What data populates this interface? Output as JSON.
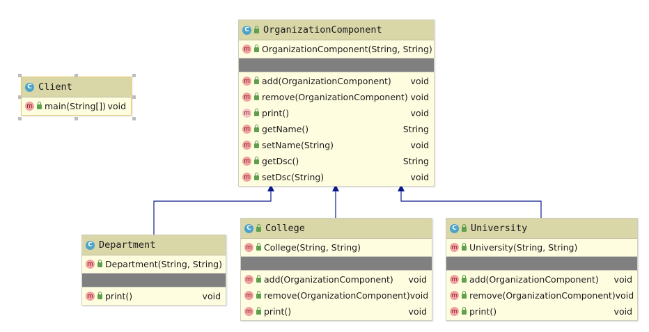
{
  "classes": {
    "client": {
      "icon": "class-icon",
      "name": "Client",
      "methods": [
        {
          "icon": "method-icon",
          "name": "main(String[])",
          "ret": "void"
        }
      ]
    },
    "organization": {
      "icon": "abstract-class-icon",
      "name": "OrganizationComponent",
      "constructors": [
        {
          "name": "OrganizationComponent(String, String)"
        }
      ],
      "methods": [
        {
          "name": "add(OrganizationComponent)",
          "ret": "void"
        },
        {
          "name": "remove(OrganizationComponent)",
          "ret": "void"
        },
        {
          "name": "print()",
          "ret": "void",
          "abstract": true
        },
        {
          "name": "getName()",
          "ret": "String"
        },
        {
          "name": "setName(String)",
          "ret": "void"
        },
        {
          "name": "getDsc()",
          "ret": "String"
        },
        {
          "name": "setDsc(String)",
          "ret": "void"
        }
      ]
    },
    "department": {
      "icon": "class-icon",
      "name": "Department",
      "constructors": [
        {
          "name": "Department(String, String)"
        }
      ],
      "methods": [
        {
          "name": "print()",
          "ret": "void"
        }
      ]
    },
    "college": {
      "icon": "class-icon",
      "name": "College",
      "constructors": [
        {
          "name": "College(String, String)"
        }
      ],
      "methods": [
        {
          "name": "add(OrganizationComponent)",
          "ret": "void"
        },
        {
          "name": "remove(OrganizationComponent)",
          "ret": "void"
        },
        {
          "name": "print()",
          "ret": "void"
        }
      ]
    },
    "university": {
      "icon": "class-icon",
      "name": "University",
      "constructors": [
        {
          "name": "University(String, String)"
        }
      ],
      "methods": [
        {
          "name": "add(OrganizationComponent)",
          "ret": "void"
        },
        {
          "name": "remove(OrganizationComponent)",
          "ret": "void"
        },
        {
          "name": "print()",
          "ret": "void"
        }
      ]
    }
  },
  "icons": {
    "class_letter": "C",
    "method_letter": "m",
    "lock": "public-lock-icon"
  },
  "colors": {
    "inheritance_arrow": "#0a1a8c",
    "header": "#d9d6a8",
    "body": "#fefde0",
    "separator": "#808080"
  },
  "relations": [
    {
      "type": "generalization",
      "from": "Department",
      "to": "OrganizationComponent"
    },
    {
      "type": "generalization",
      "from": "College",
      "to": "OrganizationComponent"
    },
    {
      "type": "generalization",
      "from": "University",
      "to": "OrganizationComponent"
    }
  ]
}
